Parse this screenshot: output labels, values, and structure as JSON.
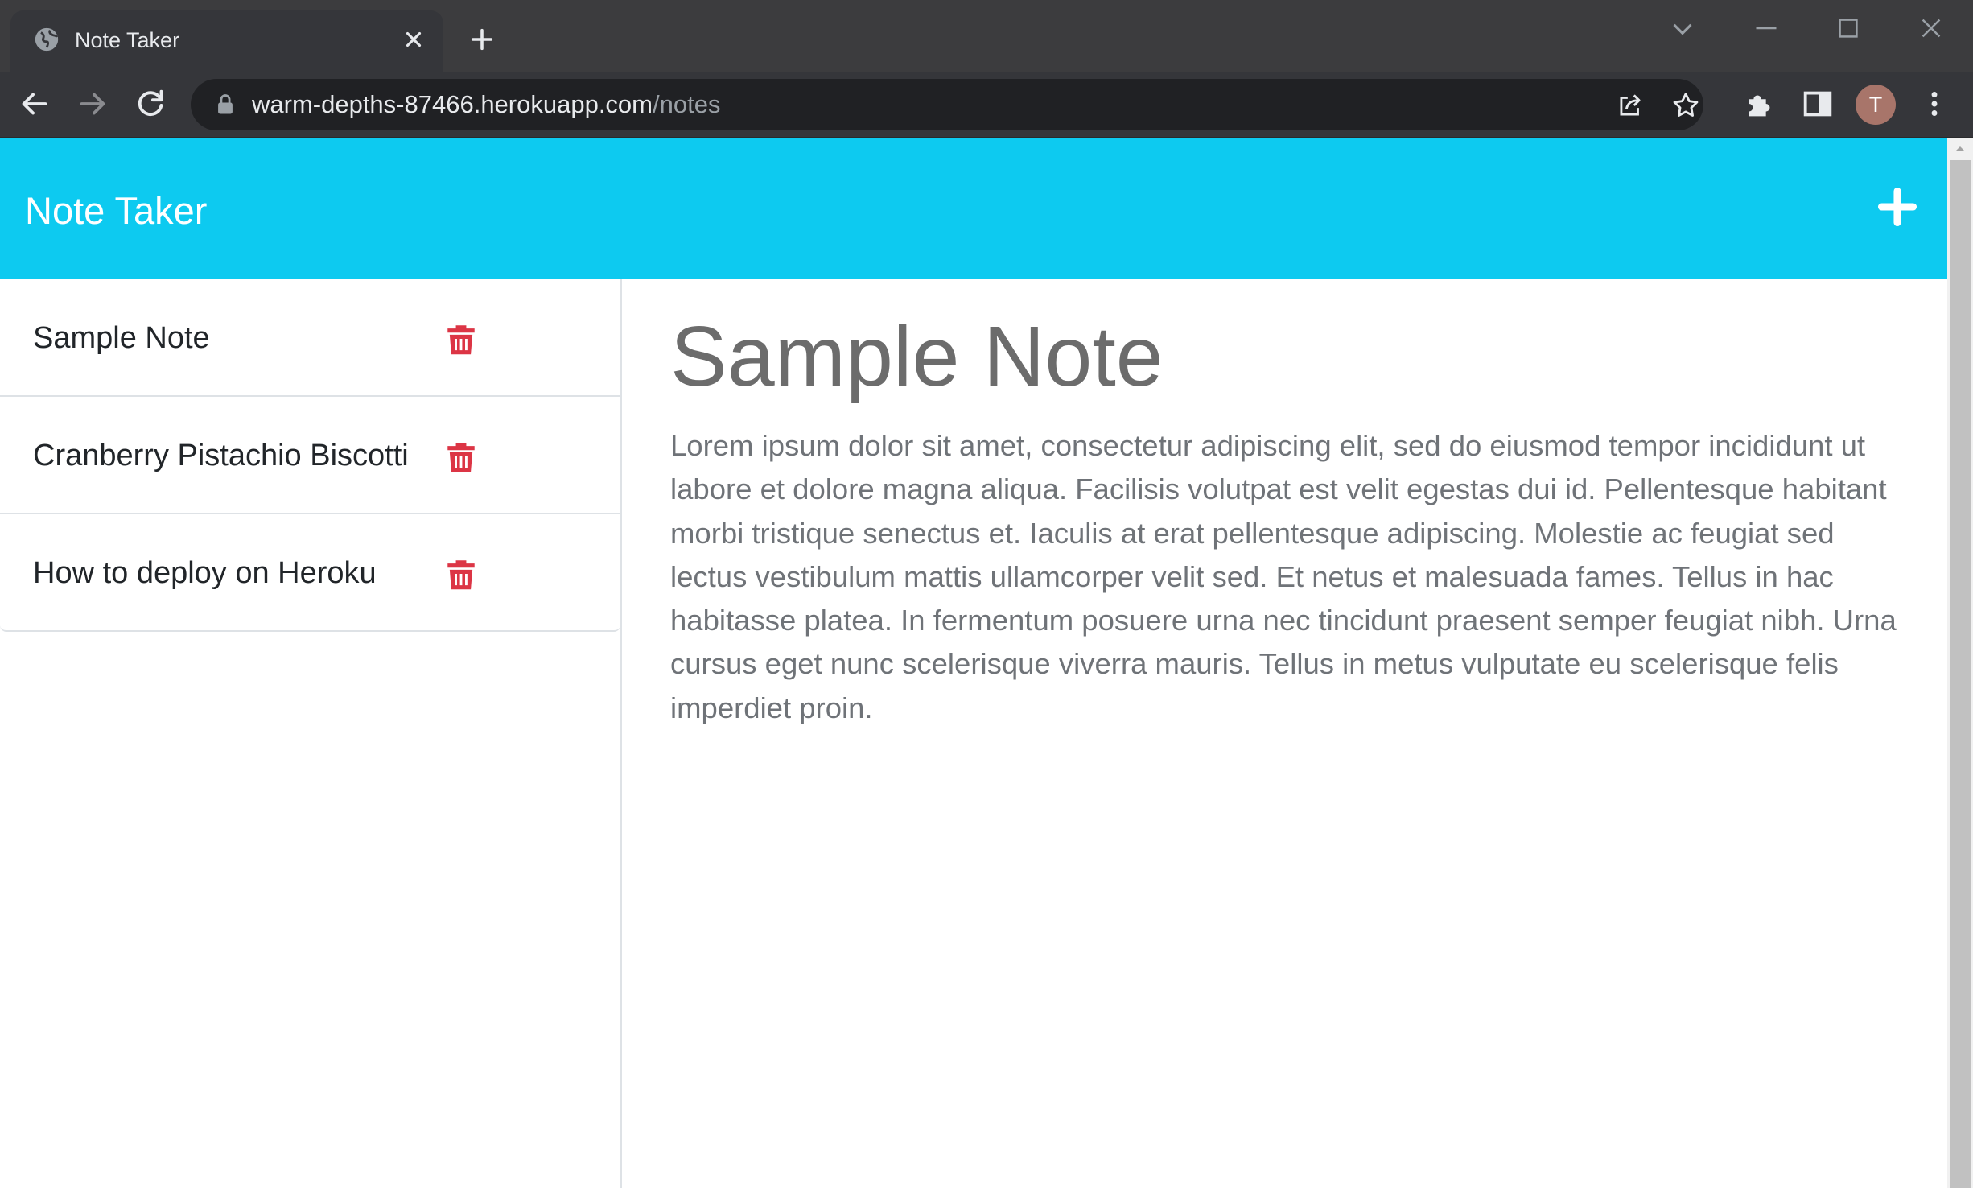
{
  "browser": {
    "tab_title": "Note Taker",
    "url_host": "warm-depths-87466.herokuapp.com",
    "url_path": "/notes",
    "profile_initial": "T"
  },
  "app": {
    "brand": "Note Taker",
    "accent_color": "#0dcaf0",
    "delete_color": "#dc3545",
    "add_icon": "plus-icon"
  },
  "notes": [
    {
      "title": "Sample Note"
    },
    {
      "title": "Cranberry Pistachio Biscotti"
    },
    {
      "title": "How to deploy on Heroku"
    }
  ],
  "active_note": {
    "title": "Sample Note",
    "text": "Lorem ipsum dolor sit amet, consectetur adipiscing elit, sed do eiusmod tempor incididunt ut labore et dolore magna aliqua. Facilisis volutpat est velit egestas dui id. Pellentesque habitant morbi tristique senectus et. Iaculis at erat pellentesque adipiscing. Molestie ac feugiat sed lectus vestibulum mattis ullamcorper velit sed. Et netus et malesuada fames. Tellus in hac habitasse platea. In fermentum posuere urna nec tincidunt praesent semper feugiat nibh. Urna cursus eget nunc scelerisque viverra mauris. Tellus in metus vulputate eu scelerisque felis imperdiet proin."
  }
}
